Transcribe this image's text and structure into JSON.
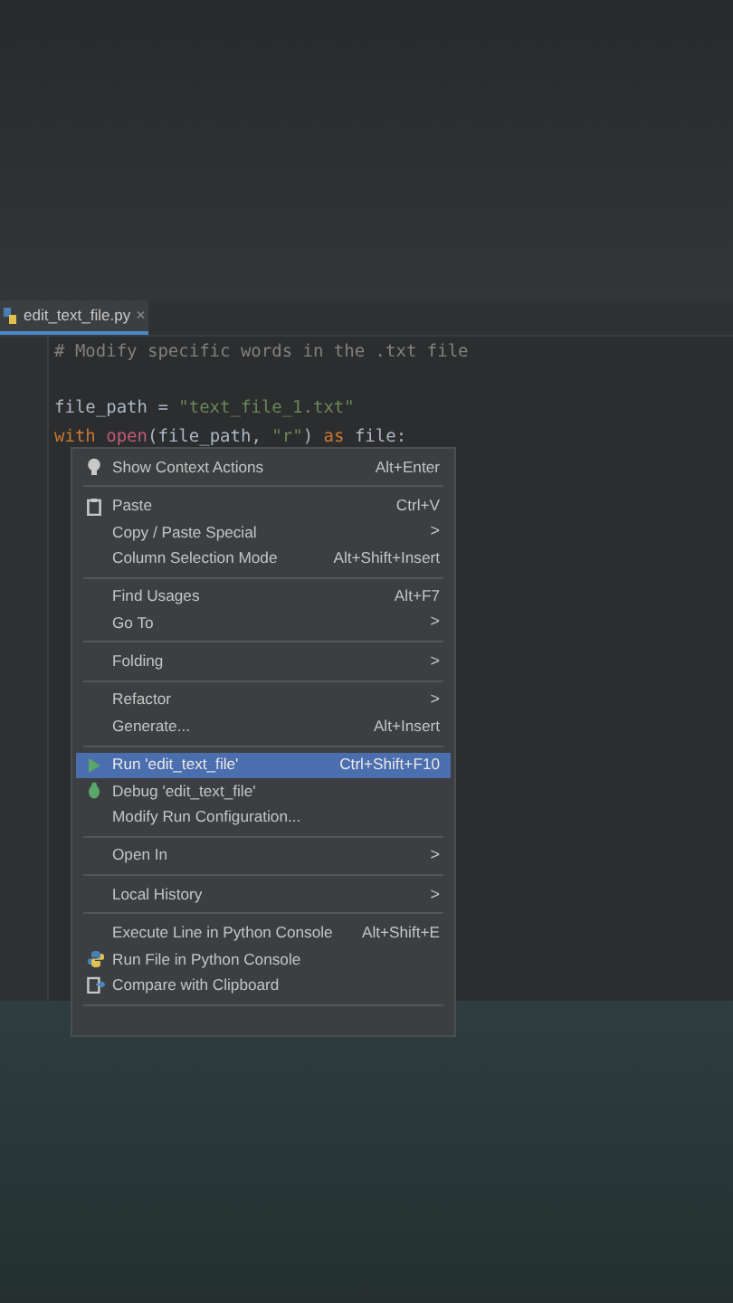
{
  "editor_tab": {
    "label": "edit_text_file.py",
    "close": "×"
  },
  "code_lines": [
    {
      "kind": "code",
      "tokens": [
        {
          "kind": "comment",
          "text": "# Modify specific words in the .txt file"
        }
      ]
    },
    {
      "kind": "blank"
    },
    {
      "kind": "code",
      "tokens": [
        {
          "kind": "plain",
          "text": "file_path = "
        },
        {
          "kind": "string",
          "text": "\"text_file_1.txt\""
        }
      ]
    },
    {
      "kind": "code",
      "tokens": [
        {
          "kind": "keyword",
          "text": "with "
        },
        {
          "kind": "builtin",
          "text": "open"
        },
        {
          "kind": "plain",
          "text": "(file_path, "
        },
        {
          "kind": "string",
          "text": "\"r\""
        },
        {
          "kind": "plain",
          "text": ") "
        },
        {
          "kind": "keyword",
          "text": "as "
        },
        {
          "kind": "plain",
          "text": "file:"
        }
      ]
    }
  ],
  "context_menu": [
    {
      "kind": "item",
      "label": "Show Context Actions",
      "shortcut": "Alt+Enter",
      "selected": false
    },
    {
      "kind": "separator"
    },
    {
      "kind": "item",
      "label": "Paste",
      "shortcut": "Ctrl+V",
      "selected": false
    },
    {
      "kind": "submenu",
      "label": "Copy / Paste Special",
      "arrow": ">",
      "selected": false
    },
    {
      "kind": "item",
      "label": "Column Selection Mode",
      "shortcut": "Alt+Shift+Insert",
      "selected": false
    },
    {
      "kind": "separator"
    },
    {
      "kind": "item",
      "label": "Find Usages",
      "shortcut": "Alt+F7",
      "selected": false
    },
    {
      "kind": "submenu",
      "label": "Go To",
      "arrow": ">",
      "selected": false
    },
    {
      "kind": "separator"
    },
    {
      "kind": "submenu",
      "label": "Folding",
      "arrow": ">",
      "selected": false
    },
    {
      "kind": "separator"
    },
    {
      "kind": "submenu",
      "label": "Refactor",
      "arrow": ">",
      "selected": false
    },
    {
      "kind": "item",
      "label": "Generate...",
      "shortcut": "Alt+Insert",
      "selected": false
    },
    {
      "kind": "separator"
    },
    {
      "kind": "item",
      "label": "Run 'edit_text_file'",
      "shortcut": "Ctrl+Shift+F10",
      "selected": true
    },
    {
      "kind": "item",
      "label": "Debug 'edit_text_file'",
      "selected": false
    },
    {
      "kind": "item",
      "label": "Modify Run Configuration...",
      "selected": false
    },
    {
      "kind": "separator"
    },
    {
      "kind": "submenu",
      "label": "Open In",
      "arrow": ">",
      "selected": false
    },
    {
      "kind": "separator"
    },
    {
      "kind": "submenu",
      "label": "Local History",
      "arrow": ">",
      "selected": false
    },
    {
      "kind": "separator"
    },
    {
      "kind": "item",
      "label": "Execute Line in Python Console",
      "shortcut": "Alt+Shift+E",
      "selected": false
    },
    {
      "kind": "item",
      "label": "Run File in Python Console",
      "selected": false
    },
    {
      "kind": "item",
      "label": "Compare with Clipboard",
      "selected": false
    },
    {
      "kind": "separator"
    }
  ]
}
